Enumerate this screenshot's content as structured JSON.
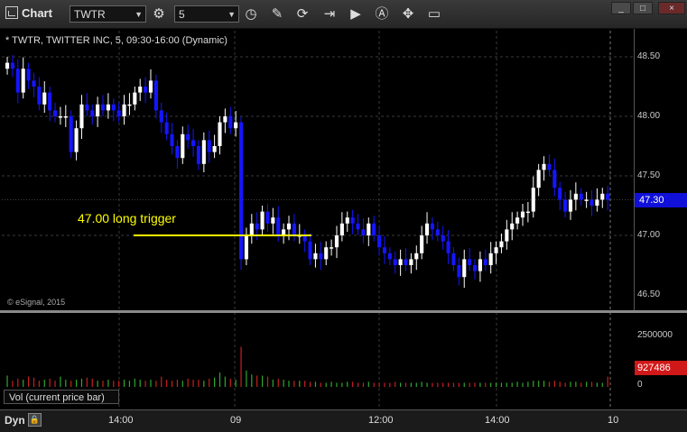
{
  "window": {
    "title": "Chart",
    "minimize": "_",
    "maximize": "□",
    "close": "×"
  },
  "toolbar": {
    "symbol": "TWTR",
    "interval": "5"
  },
  "chart": {
    "label": "* TWTR, TWITTER INC, 5, 09:30-16:00 (Dynamic)",
    "copyright": "© eSignal, 2015",
    "annotation": "47.00 long trigger",
    "price_ticks": [
      "48.50",
      "48.00",
      "47.50",
      "47.00",
      "46.50"
    ],
    "last_price": "47.30",
    "colors": {
      "up": "#ffffff",
      "down": "#1515ff",
      "trigger": "#ffff00",
      "vol_up": "#2ea82e",
      "vol_down": "#c82020",
      "grid": "#3a3a3a"
    }
  },
  "volume": {
    "label": "Vol (current price bar)",
    "ticks": [
      "2500000",
      "0"
    ],
    "last_volume": "927486"
  },
  "time_axis": {
    "ticks": [
      "14:00",
      "09",
      "12:00",
      "14:00",
      "10"
    ],
    "mode": "Dyn"
  },
  "chart_data": {
    "type": "candlestick",
    "y_range": [
      46.5,
      48.6
    ],
    "trigger_price": 47.0,
    "closes": [
      48.45,
      48.4,
      48.2,
      48.4,
      48.3,
      48.25,
      48.1,
      48.2,
      48.05,
      48.0,
      48.0,
      48.0,
      47.7,
      47.9,
      48.1,
      48.05,
      48.0,
      48.1,
      48.05,
      48.1,
      48.05,
      48.0,
      48.1,
      48.1,
      48.2,
      48.25,
      48.2,
      48.3,
      48.05,
      47.95,
      47.85,
      47.75,
      47.65,
      47.85,
      47.8,
      47.75,
      47.6,
      47.8,
      47.7,
      47.75,
      47.95,
      48.0,
      47.9,
      47.95,
      46.8,
      47.0,
      47.1,
      47.05,
      47.2,
      47.1,
      47.15,
      47.0,
      47.05,
      47.1,
      47.0,
      47.0,
      46.95,
      46.8,
      46.85,
      46.8,
      46.9,
      46.9,
      47.0,
      47.1,
      47.15,
      47.1,
      47.05,
      47.0,
      47.1,
      47.0,
      46.9,
      46.85,
      46.8,
      46.75,
      46.8,
      46.75,
      46.8,
      46.85,
      47.0,
      47.1,
      47.05,
      47.0,
      46.95,
      46.85,
      46.75,
      46.65,
      46.8,
      46.75,
      46.7,
      46.8,
      46.75,
      46.85,
      46.9,
      46.95,
      47.05,
      47.1,
      47.15,
      47.2,
      47.2,
      47.4,
      47.55,
      47.6,
      47.55,
      47.4,
      47.3,
      47.2,
      47.3,
      47.35,
      47.3,
      47.3,
      47.25,
      47.3,
      47.35,
      47.3
    ],
    "volumes": [
      0.55,
      0.3,
      0.4,
      0.35,
      0.5,
      0.45,
      0.3,
      0.35,
      0.4,
      0.3,
      0.5,
      0.35,
      0.3,
      0.35,
      0.4,
      0.45,
      0.4,
      0.3,
      0.3,
      0.35,
      0.3,
      0.3,
      0.35,
      0.3,
      0.4,
      0.35,
      0.3,
      0.35,
      0.3,
      0.5,
      0.35,
      0.3,
      0.35,
      0.3,
      0.4,
      0.35,
      0.35,
      0.3,
      0.4,
      0.45,
      0.7,
      0.5,
      0.4,
      0.35,
      1.95,
      0.8,
      0.6,
      0.55,
      0.55,
      0.5,
      0.35,
      0.4,
      0.35,
      0.3,
      0.3,
      0.3,
      0.3,
      0.25,
      0.25,
      0.2,
      0.2,
      0.25,
      0.2,
      0.2,
      0.25,
      0.25,
      0.2,
      0.2,
      0.25,
      0.2,
      0.2,
      0.2,
      0.2,
      0.25,
      0.2,
      0.2,
      0.2,
      0.2,
      0.25,
      0.2,
      0.2,
      0.2,
      0.2,
      0.2,
      0.2,
      0.2,
      0.2,
      0.2,
      0.2,
      0.2,
      0.2,
      0.2,
      0.2,
      0.2,
      0.2,
      0.2,
      0.25,
      0.2,
      0.25,
      0.3,
      0.3,
      0.3,
      0.25,
      0.3,
      0.25,
      0.2,
      0.25,
      0.25,
      0.2,
      0.25,
      0.25,
      0.2,
      0.2,
      0.5
    ]
  }
}
